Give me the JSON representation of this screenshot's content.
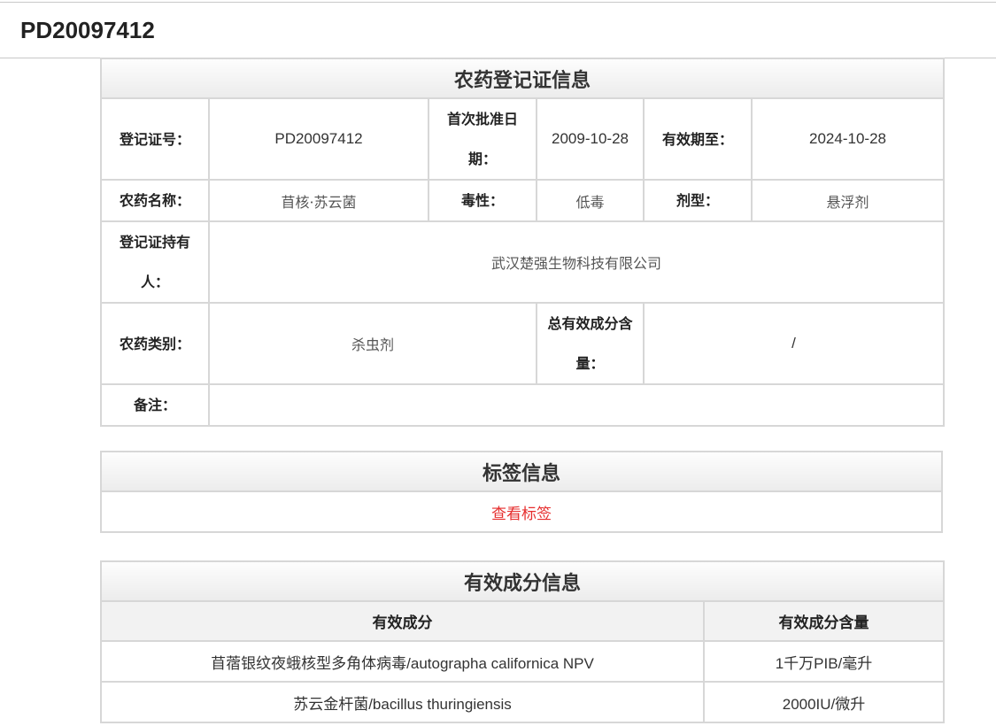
{
  "page": {
    "title": "PD20097412"
  },
  "registration": {
    "caption": "农药登记证信息",
    "reg_no_label": "登记证号：",
    "reg_no": "PD20097412",
    "first_approval_label": "首次批准日期：",
    "first_approval": "2009-10-28",
    "valid_until_label": "有效期至：",
    "valid_until": "2024-10-28",
    "name_label": "农药名称：",
    "name": "苜核·苏云菌",
    "toxicity_label": "毒性：",
    "toxicity": "低毒",
    "formulation_label": "剂型：",
    "formulation": "悬浮剂",
    "holder_label": "登记证持有人：",
    "holder": "武汉楚强生物科技有限公司",
    "category_label": "农药类别：",
    "category": "杀虫剂",
    "total_content_label": "总有效成分含量：",
    "total_content": "/",
    "remark_label": "备注：",
    "remark": ""
  },
  "label_info": {
    "caption": "标签信息",
    "view_link": "查看标签"
  },
  "ingredients": {
    "caption": "有效成分信息",
    "headers": [
      "有效成分",
      "有效成分含量"
    ],
    "rows": [
      {
        "name": "苜蓿银纹夜蛾核型多角体病毒/autographa californica NPV",
        "content": "1千万PIB/毫升"
      },
      {
        "name": "苏云金杆菌/bacillus thuringiensis",
        "content": "2000IU/微升"
      }
    ]
  }
}
